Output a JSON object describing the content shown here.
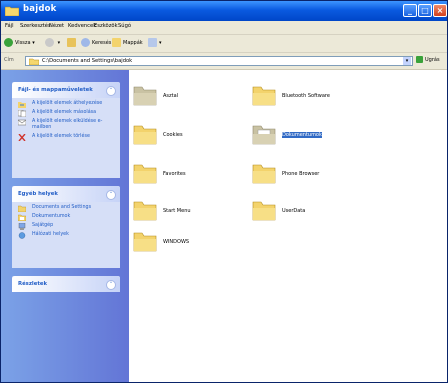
{
  "window": {
    "title": "bajdok"
  },
  "menu": [
    "Fájl",
    "Szerkesztés",
    "Nézet",
    "Kedvencek",
    "Eszközök",
    "Súgó"
  ],
  "toolbar": {
    "back_label": "Vissza",
    "search_label": "Keresés",
    "folders_label": "Mappák"
  },
  "address": {
    "label": "Cím",
    "path": "C:\\Documents and Settings\\bajdok",
    "go_label": "Ugrás"
  },
  "tasks": {
    "title": "Fájl- és mappaműveletek",
    "items": [
      "A kijelölt elemek áthelyezése",
      "A kijelölt elemek másolása",
      "A kijelölt elemek elküldése e-mailben",
      "A kijelölt elemek törlése"
    ]
  },
  "other_places": {
    "title": "Egyéb helyek",
    "items": [
      "Documents and Settings",
      "Dokumentumok",
      "Sajátgép",
      "Hálózati helyek"
    ]
  },
  "details": {
    "title": "Részletek"
  },
  "folders": [
    {
      "name": "Asztal"
    },
    {
      "name": "Bluetooth Software"
    },
    {
      "name": "Cookies"
    },
    {
      "name": "Dokumentumok"
    },
    {
      "name": "Favorites"
    },
    {
      "name": "Phone Browser"
    },
    {
      "name": "Start Menu"
    },
    {
      "name": "UserData"
    },
    {
      "name": "WINDOWS"
    }
  ],
  "colors": {
    "title_bar": "#0a5ae0",
    "task_pane": "#6f8ce0",
    "folder_yellow": "#f3d36c",
    "link_blue": "#215dc6"
  }
}
